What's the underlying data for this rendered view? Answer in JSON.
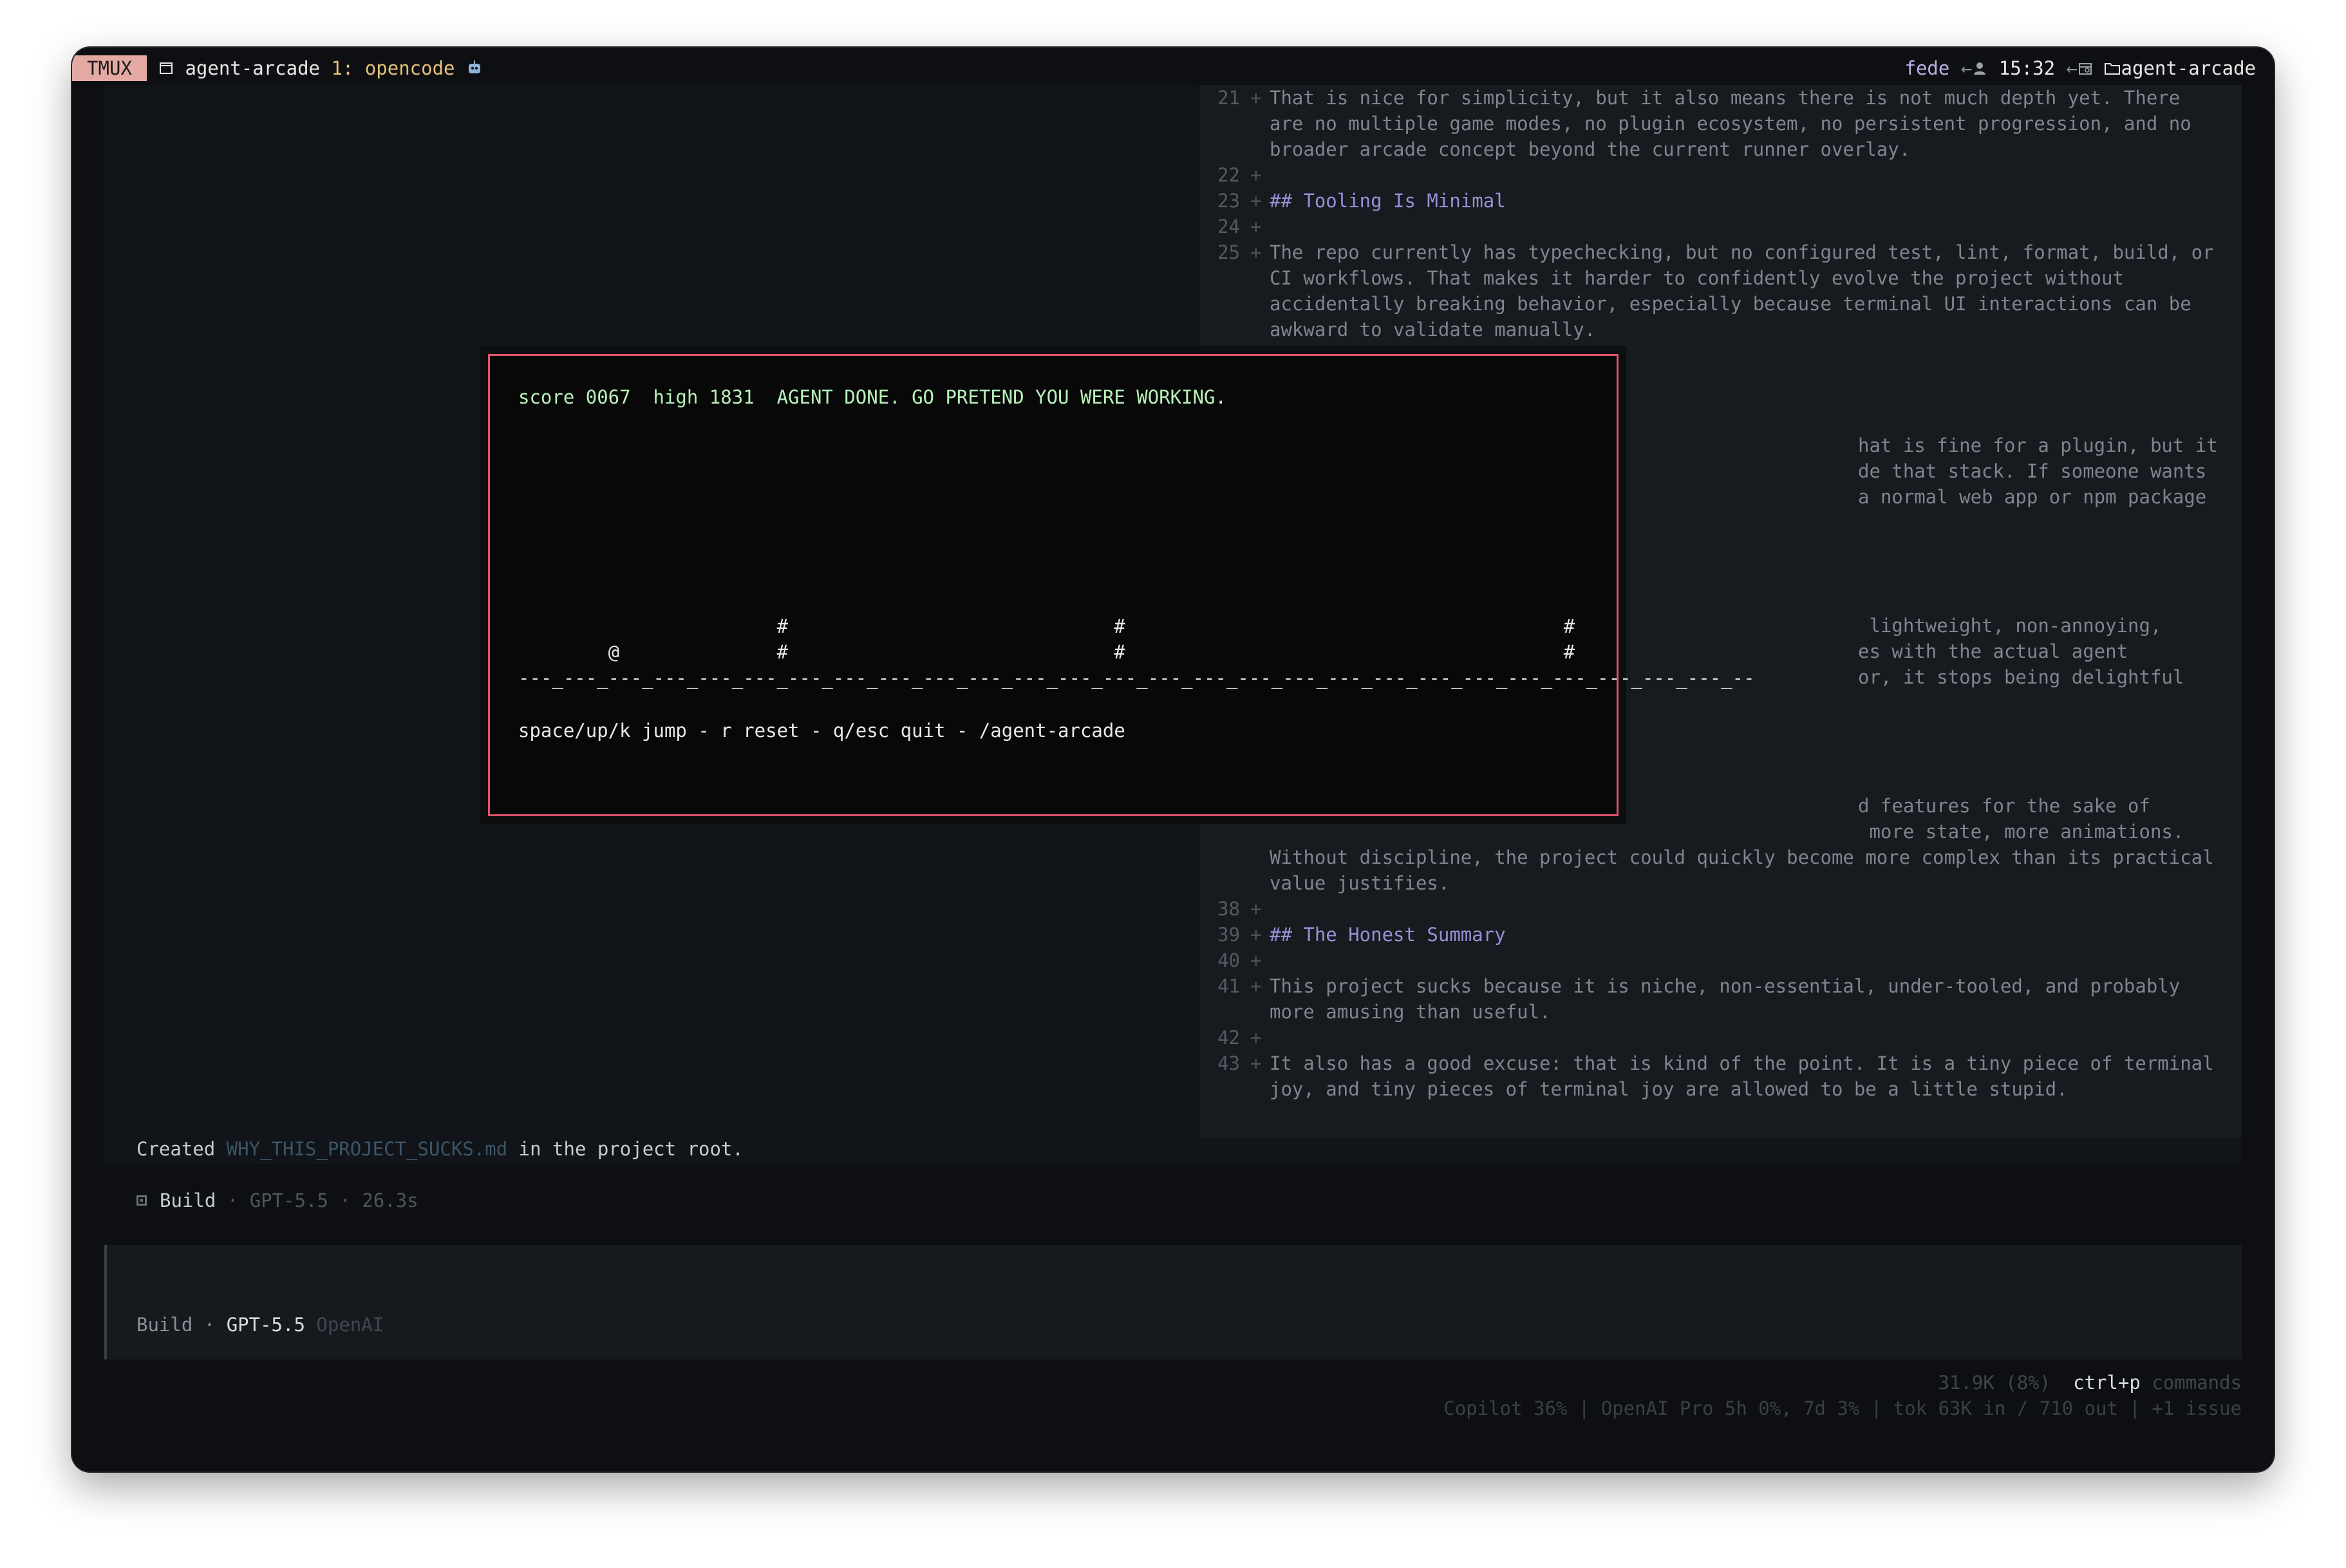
{
  "tmux": {
    "badge": "TMUX",
    "session": "agent-arcade",
    "window_index": "1:",
    "window_name": "opencode",
    "user": "fede",
    "time": "15:32",
    "folder": "agent-arcade"
  },
  "diff": [
    {
      "ln": "21",
      "text": "That is nice for simplicity, but it also means there is not much depth yet. There"
    },
    {
      "ln": "",
      "text": "are no multiple game modes, no plugin ecosystem, no persistent progression, and no"
    },
    {
      "ln": "",
      "text": "broader arcade concept beyond the current runner overlay."
    },
    {
      "ln": "22",
      "text": ""
    },
    {
      "ln": "23",
      "text": "## Tooling Is Minimal",
      "heading": true
    },
    {
      "ln": "24",
      "text": ""
    },
    {
      "ln": "25",
      "text": "The repo currently has typechecking, but no configured test, lint, format, build, or"
    },
    {
      "ln": "",
      "text": "CI workflows. That makes it harder to confidently evolve the project without"
    },
    {
      "ln": "",
      "text": "accidentally breaking behavior, especially because terminal UI interactions can be"
    },
    {
      "ln": "",
      "text": "awkward to validate manually."
    }
  ],
  "diff_right_fragments": [
    "hat is fine for a plugin, but it",
    "de that stack. If someone wants",
    "a normal web app or npm package",
    " lightweight, non-annoying,",
    "es with the actual agent",
    "or, it stops being delightful",
    "d features for the sake of",
    " more state, more animations."
  ],
  "diff_lower": [
    {
      "ln": "",
      "text": "Without discipline, the project could quickly become more complex than its practical"
    },
    {
      "ln": "",
      "text": "value justifies."
    },
    {
      "ln": "38",
      "text": ""
    },
    {
      "ln": "39",
      "text": "## The Honest Summary",
      "heading": true
    },
    {
      "ln": "40",
      "text": ""
    },
    {
      "ln": "41",
      "text": "This project sucks because it is niche, non-essential, under-tooled, and probably"
    },
    {
      "ln": "",
      "text": "more amusing than useful."
    },
    {
      "ln": "42",
      "text": ""
    },
    {
      "ln": "43",
      "text": "It also has a good excuse: that is kind of the point. It is a tiny piece of terminal"
    },
    {
      "ln": "",
      "text": "joy, and tiny pieces of terminal joy are allowed to be a little stupid."
    }
  ],
  "game": {
    "status": "score 0067  high 1831  AGENT DONE. GO PRETEND YOU WERE WORKING.",
    "row1": "                       #                             #                                       #",
    "row2": "        @              #                             #                                       #",
    "ground": "---_---_---_---_---_---_---_---_---_---_---_---_---_---_---_---_---_---_---_---_---_---_---_---_---_---_---_--",
    "help": "space/up/k jump - r reset - q/esc quit - /agent-arcade"
  },
  "message": {
    "prefix": "Created ",
    "file": "WHY_THIS_PROJECT_SUCKS.md",
    "suffix": " in the project root."
  },
  "build": {
    "label": "Build",
    "model": "GPT-5.5",
    "duration": "26.3s",
    "sep": "·"
  },
  "input": {
    "mode": "Build",
    "model": "GPT-5.5",
    "provider": "OpenAI"
  },
  "footer": {
    "tokens": "31.9K (8%)",
    "shortcut": "ctrl+p",
    "shortcut_label": "commands",
    "status": "Copilot 36% | OpenAI Pro 5h 0%, 7d 3% | tok 63K in / 710 out | +1 issue"
  }
}
